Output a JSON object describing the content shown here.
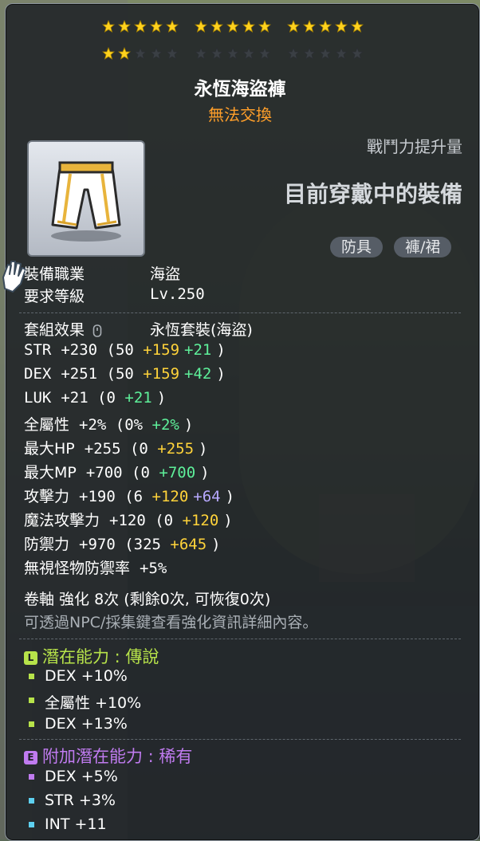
{
  "star_force": {
    "filled": 17,
    "total": 30,
    "colors": {
      "filled": "#ffd21e",
      "empty": "#3a3f44"
    }
  },
  "item": {
    "name": "永恆海盜褲",
    "trade_status": "無法交換"
  },
  "compare": {
    "title": "戰鬥力提升量",
    "status": "目前穿戴中的裝備"
  },
  "tags": [
    "防具",
    "褲/裙"
  ],
  "requirements": {
    "job_label": "裝備職業",
    "job_value": "海盜",
    "level_label": "要求等級",
    "level_value": "Lv.250"
  },
  "set_effect": {
    "label": "套組效果",
    "value": "永恆套裝(海盜)"
  },
  "stats": [
    {
      "name": "STR",
      "text": "+230 (50 ",
      "y": "+159",
      "g": "+21",
      "p": "",
      "close": ")"
    },
    {
      "name": "DEX",
      "text": "+251 (50 ",
      "y": "+159",
      "g": "+42",
      "p": "",
      "close": ")"
    },
    {
      "name": "LUK",
      "text": "+21 (0 ",
      "y": "",
      "g": "+21",
      "p": "",
      "close": ")"
    },
    {
      "name": "全屬性",
      "text": "+2% (0% ",
      "y": "",
      "g": "+2%",
      "p": "",
      "close": ")"
    },
    {
      "name": "最大HP",
      "text": "+255 (0 ",
      "y": "+255",
      "g": "",
      "p": "",
      "close": ")"
    },
    {
      "name": "最大MP",
      "text": "+700 (0 ",
      "y": "",
      "g": "+700",
      "p": "",
      "close": ")"
    },
    {
      "name": "攻擊力",
      "text": "+190 (6 ",
      "y": "+120",
      "g": "",
      "p": "+64",
      "close": ")"
    },
    {
      "name": "魔法攻擊力",
      "text": "+120 (0 ",
      "y": "+120",
      "g": "",
      "p": "",
      "close": ")"
    },
    {
      "name": "防禦力",
      "text": "+970 (325 ",
      "y": "+645",
      "g": "",
      "p": "",
      "close": ")"
    },
    {
      "name": "無視怪物防禦率",
      "text": "+5%",
      "y": "",
      "g": "",
      "p": "",
      "close": ""
    }
  ],
  "upgrade": {
    "line": "卷軸 強化 8次 (剩餘0次, 可恢復0次)",
    "hint": "可透過NPC/採集鍵查看強化資訊詳細內容。"
  },
  "potential": {
    "badge": "L",
    "title": "潛在能力 : 傳說",
    "color": "#b7e34a",
    "lines": [
      "DEX +10%",
      "全屬性 +10%",
      "DEX +13%"
    ]
  },
  "additional_potential": {
    "badge": "E",
    "title": "附加潛在能力 : 稀有",
    "color": "#c07bf0",
    "lines": [
      "DEX +5%",
      "STR +3%",
      "INT +11"
    ],
    "bullet_colors": [
      "#c07bf0",
      "#5ed0f0",
      "#5ed0f0"
    ]
  }
}
